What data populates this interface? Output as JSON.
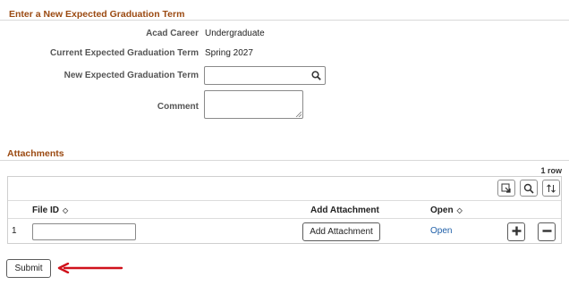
{
  "form": {
    "title": "Enter a New Expected Graduation Term",
    "acad_career_label": "Acad Career",
    "acad_career_value": "Undergraduate",
    "current_term_label": "Current Expected Graduation Term",
    "current_term_value": "Spring 2027",
    "new_term_label": "New Expected Graduation Term",
    "new_term_value": "",
    "comment_label": "Comment",
    "comment_value": ""
  },
  "attachments": {
    "title": "Attachments",
    "row_count": "1 row",
    "toolbar": [
      "export-icon",
      "search-icon",
      "sort-icon"
    ],
    "columns": {
      "file_id": "File ID",
      "add_attachment": "Add Attachment",
      "open": "Open"
    },
    "rows": [
      {
        "num": "1",
        "file_id": "",
        "add_attachment_label": "Add Attachment",
        "open_label": "Open"
      }
    ]
  },
  "footer": {
    "submit_label": "Submit"
  },
  "colors": {
    "section_title": "#9b4a12",
    "link": "#1f5fa8",
    "arrow": "#d0111b"
  }
}
